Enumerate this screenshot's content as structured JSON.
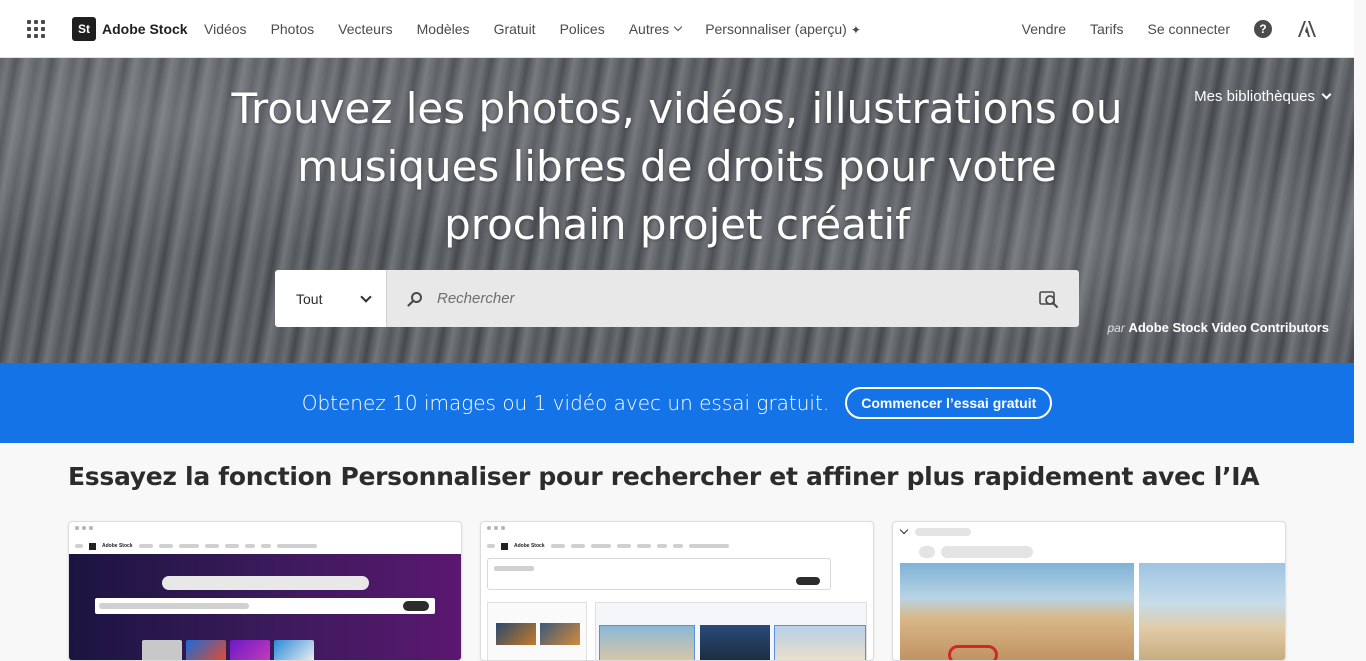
{
  "header": {
    "brand_badge": "St",
    "brand_name": "Adobe Stock",
    "nav": [
      "Vidéos",
      "Photos",
      "Vecteurs",
      "Modèles",
      "Gratuit",
      "Polices"
    ],
    "more_label": "Autres",
    "personalize_label": "Personnaliser (aperçu)",
    "right": [
      "Vendre",
      "Tarifs",
      "Se connecter"
    ],
    "help_glyph": "?"
  },
  "hero": {
    "title": "Trouvez les photos, vidéos, illustrations ou musiques libres de droits pour votre prochain projet créatif",
    "libraries_label": "Mes bibliothèques",
    "search": {
      "type_value": "Tout",
      "placeholder": "Rechercher"
    },
    "credit_prefix": "par",
    "credit_name": "Adobe Stock Video Contributors"
  },
  "promo": {
    "text": "Obtenez 10 images ou 1 vidéo avec un essai gratuit.",
    "button": "Commencer l’essai gratuit"
  },
  "section": {
    "title": "Essayez la fonction Personnaliser pour rechercher et affiner plus rapidement avec l’IA"
  },
  "cards": {
    "mini_brand": "Adobe Stock"
  },
  "colors": {
    "promo_bg": "#1473e6",
    "nav_text": "#4b4b4b"
  },
  "icons": [
    "apps-grid-icon",
    "chevron-down-icon",
    "sparkle-icon",
    "help-icon",
    "adobe-icon",
    "search-icon",
    "visual-search-icon"
  ]
}
